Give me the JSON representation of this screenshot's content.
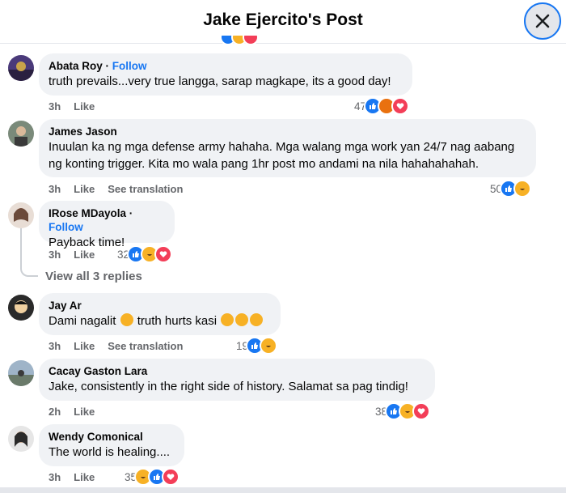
{
  "header": {
    "title": "Jake Ejercito's Post",
    "close_label": "×"
  },
  "comments": [
    {
      "author": "Abata Roy",
      "follow": "Follow",
      "text": "truth prevails...very true langga, sarap magkape, its a good day!",
      "time": "3h",
      "like": "Like",
      "reaction_count": "47",
      "reactions": [
        "like",
        "angry",
        "love"
      ]
    },
    {
      "author": "James Jason",
      "text_lines": [
        "Inuulan ka ng mga defense army hahaha. Mga walang mga work yan 24/7 nag aabang",
        "ng konting trigger. Kita mo wala pang 1hr post mo andami na nila hahahahahah."
      ],
      "time": "3h",
      "like": "Like",
      "see_translation": "See translation",
      "reaction_count": "50",
      "reactions": [
        "like",
        "haha"
      ]
    },
    {
      "author": "IRose MDayola",
      "follow": "Follow",
      "text": "Payback time!",
      "time": "3h",
      "like": "Like",
      "reaction_count": "32",
      "reactions": [
        "like",
        "haha",
        "love"
      ],
      "view_replies": "View all 3 replies"
    },
    {
      "author": "Jay Ar",
      "text_parts": [
        "Dami nagalit",
        "truth hurts kasi"
      ],
      "time": "3h",
      "like": "Like",
      "see_translation": "See translation",
      "reaction_count": "19",
      "reactions": [
        "like",
        "haha"
      ]
    },
    {
      "author": "Cacay Gaston Lara",
      "text": "Jake, consistently in the right side of history. Salamat sa pag tindig!",
      "time": "2h",
      "like": "Like",
      "reaction_count": "38",
      "reactions": [
        "like",
        "haha",
        "love"
      ]
    },
    {
      "author": "Wendy Comonical",
      "text": "The world is healing....",
      "time": "3h",
      "like": "Like",
      "reaction_count": "35",
      "reactions": [
        "haha",
        "like",
        "love"
      ]
    }
  ],
  "colors": {
    "accent": "#1877f2",
    "bubble": "#f0f2f5",
    "muted": "#65676b"
  }
}
